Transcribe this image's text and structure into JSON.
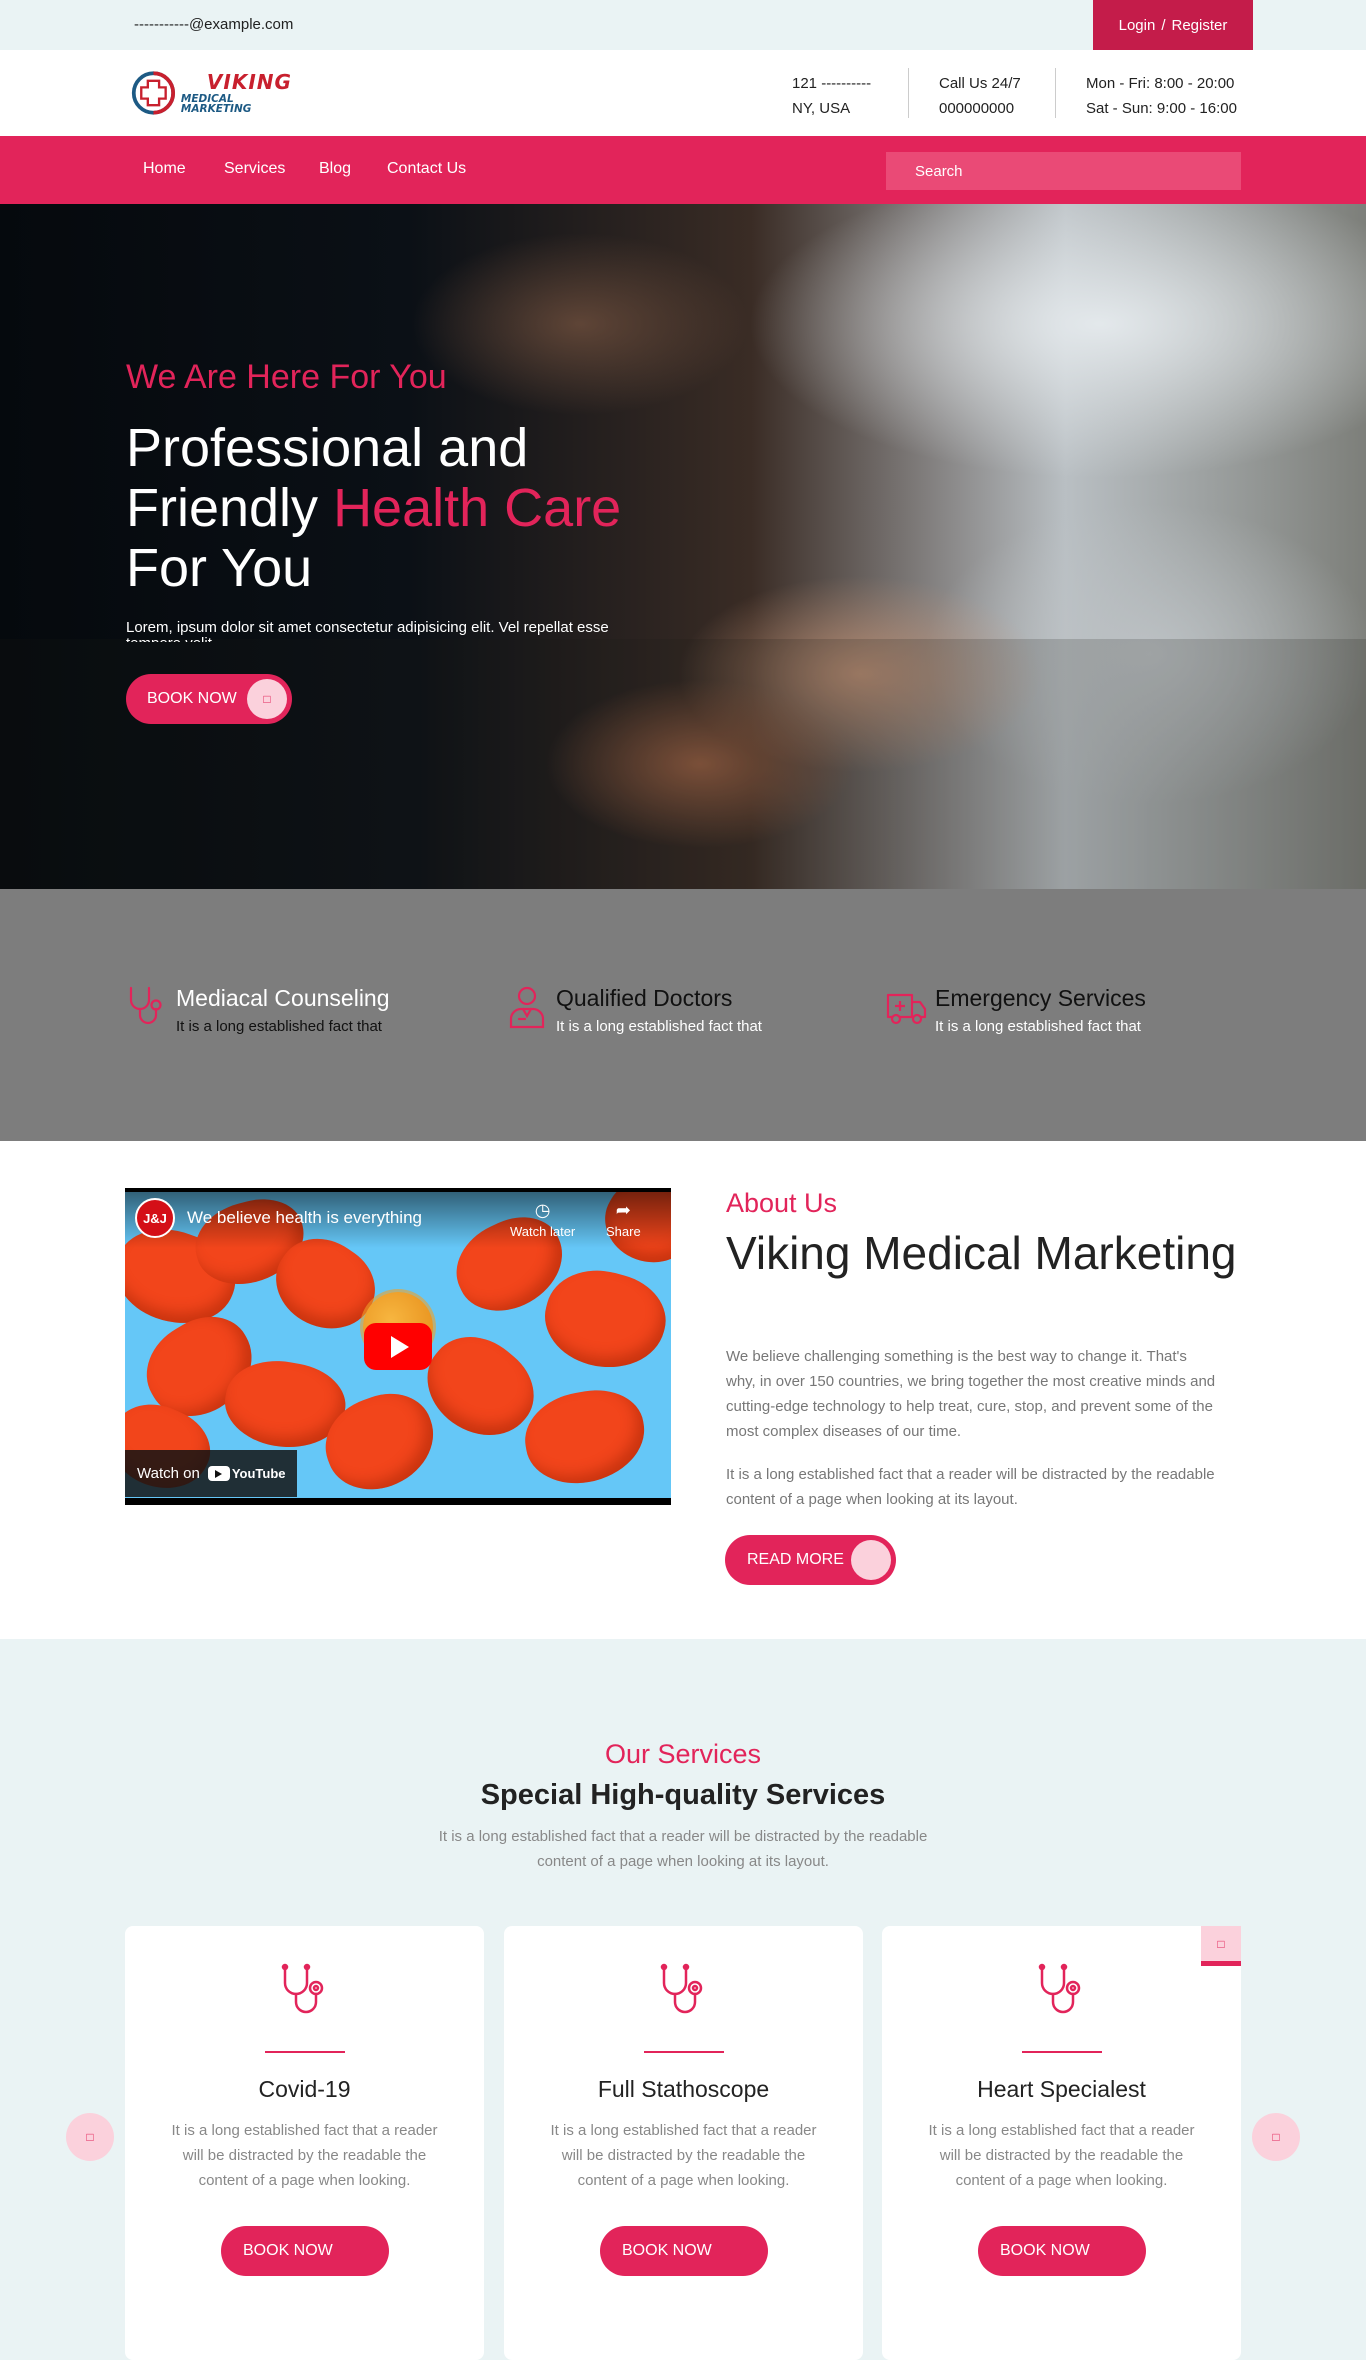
{
  "topbar": {
    "email": "-----------@example.com",
    "login_label": "Login",
    "separator": "/",
    "register_label": "Register"
  },
  "brand": {
    "name_line1": "VIKING",
    "name_line2": "MEDICAL MARKETING",
    "colors": {
      "red": "#c8202e",
      "blue": "#1d5a84"
    }
  },
  "header_info": {
    "address_line1": "121 ----------",
    "address_line2": "NY, USA",
    "phone_line1": "Call Us 24/7",
    "phone_line2": "000000000",
    "hours_line1": "Mon - Fri: 8:00 - 20:00",
    "hours_line2": "Sat - Sun: 9:00 - 16:00"
  },
  "nav": {
    "items": [
      "Home",
      "Services",
      "Blog",
      "Contact Us"
    ],
    "search_placeholder": "Search"
  },
  "hero": {
    "kicker": "We Are Here For You",
    "title_part1": "Professional and Friendly ",
    "title_highlight": "Health Care",
    "title_part2": " For You",
    "description": "Lorem, ipsum dolor sit amet consectetur adipisicing elit. Vel repellat esse tempore velit.",
    "button_label": "BOOK NOW",
    "button_icon": "arrow-icon"
  },
  "features": [
    {
      "icon": "stethoscope-icon",
      "title": "Mediacal Counseling",
      "text": "It is a long established fact that"
    },
    {
      "icon": "doctor-icon",
      "title": "Qualified Doctors",
      "text": "It is a long established fact that"
    },
    {
      "icon": "ambulance-icon",
      "title": "Emergency Services",
      "text": "It is a long established fact that"
    }
  ],
  "video": {
    "channel": "J&J",
    "title": "We believe health is everything",
    "watch_later": "Watch later",
    "share": "Share",
    "watch_on": "Watch on",
    "youtube": "YouTube"
  },
  "about": {
    "kicker": "About Us",
    "title": "Viking Medical Marketing",
    "paragraph1": "We believe challenging something is the best way to change it. That's why, in over 150 countries, we bring together the most creative minds and cutting-edge technology to help treat, cure, stop, and prevent some of the most complex diseases of our time.",
    "paragraph2": "It is a long established fact that a reader will be distracted by the readable content of a page when looking at its layout.",
    "button_label": "READ MORE"
  },
  "services": {
    "kicker": "Our Services",
    "title": "Special High-quality Services",
    "subtitle": "It is a long established fact that a reader will be distracted by the readable content of a page when looking at its layout.",
    "cards": [
      {
        "icon": "stethoscope-icon",
        "title": "Covid-19",
        "text": "It is a long established fact that a reader will be distracted by the readable the content of a page when looking.",
        "button_label": "BOOK NOW"
      },
      {
        "icon": "stethoscope-icon",
        "title": "Full Stathoscope",
        "text": "It is a long established fact that a reader will be distracted by the readable the content of a page when looking.",
        "button_label": "BOOK NOW"
      },
      {
        "icon": "stethoscope-icon",
        "title": "Heart Specialest",
        "text": "It is a long established fact that a reader will be distracted by the readable the content of a page when looking.",
        "button_label": "BOOK NOW"
      }
    ],
    "prev_icon": "chevron-left-icon",
    "next_icon": "chevron-right-icon"
  },
  "colors": {
    "accent": "#e2245a",
    "accent_dark": "#c41c4a",
    "accent_light": "#fbd1dc",
    "pale_bg": "#eaf3f4",
    "gray_band": "#7d7d7d"
  }
}
